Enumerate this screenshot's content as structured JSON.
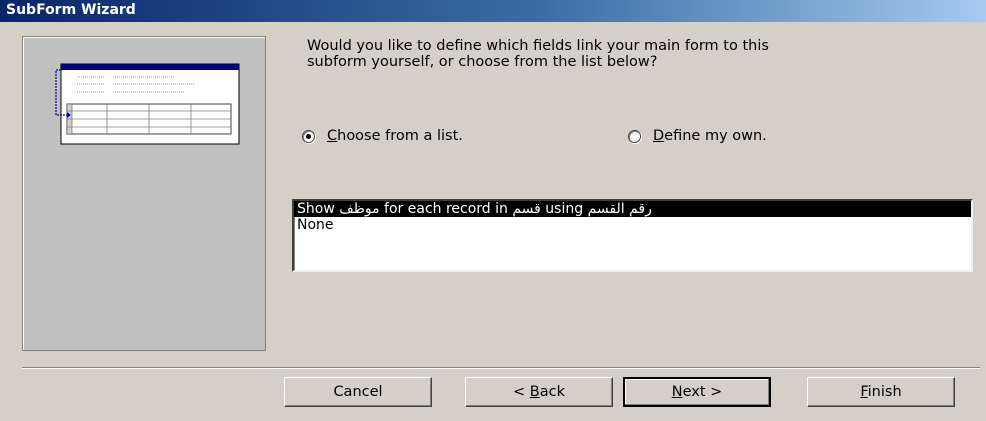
{
  "window": {
    "title": "SubForm Wizard"
  },
  "question": {
    "line1": "Would you like to define which fields link your main form to this",
    "line2": "subform yourself, or choose from the list below?"
  },
  "options": {
    "choose_prefix": "C",
    "choose_rest": "hoose from a list.",
    "choose_checked": true,
    "define_prefix": "D",
    "define_rest": "efine my own.",
    "define_checked": false
  },
  "list": {
    "items": [
      "Show موظف for each record in قسم using رقم القسم",
      "None"
    ],
    "selected_index": 0
  },
  "buttons": {
    "cancel": "Cancel",
    "back_pre": "< ",
    "back_accel": "B",
    "back_rest": "ack",
    "next_accel": "N",
    "next_rest": "ext >",
    "finish_accel": "F",
    "finish_rest": "inish"
  },
  "colors": {
    "dialog_bg": "#d4d0c8",
    "titlebar_start": "#0a246a",
    "titlebar_end": "#a6caf0",
    "selection_bg": "#000000"
  }
}
